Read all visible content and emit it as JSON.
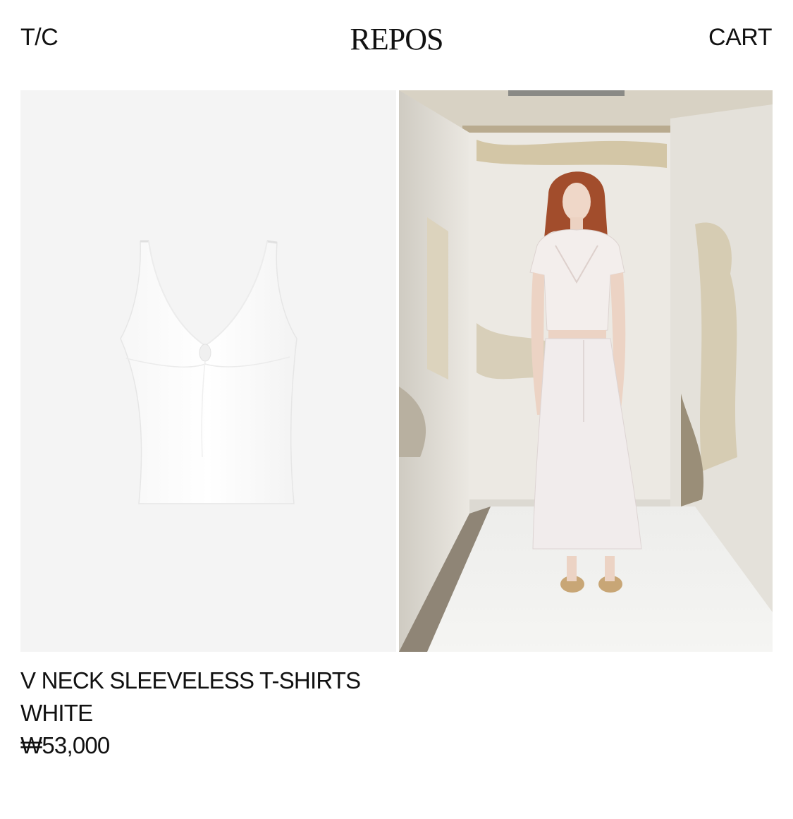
{
  "header": {
    "left_link": "T/C",
    "logo": "REPOS",
    "right_link": "CART"
  },
  "gallery": {
    "images": [
      {
        "alt": "product-flat-image"
      },
      {
        "alt": "model-image"
      }
    ]
  },
  "product": {
    "name": "V NECK SLEEVELESS T-SHIRTS",
    "color": "WHITE",
    "price": "₩53,000"
  },
  "colors": {
    "text": "#111111",
    "background": "#ffffff",
    "product_panel_bg": "#f4f4f4"
  }
}
